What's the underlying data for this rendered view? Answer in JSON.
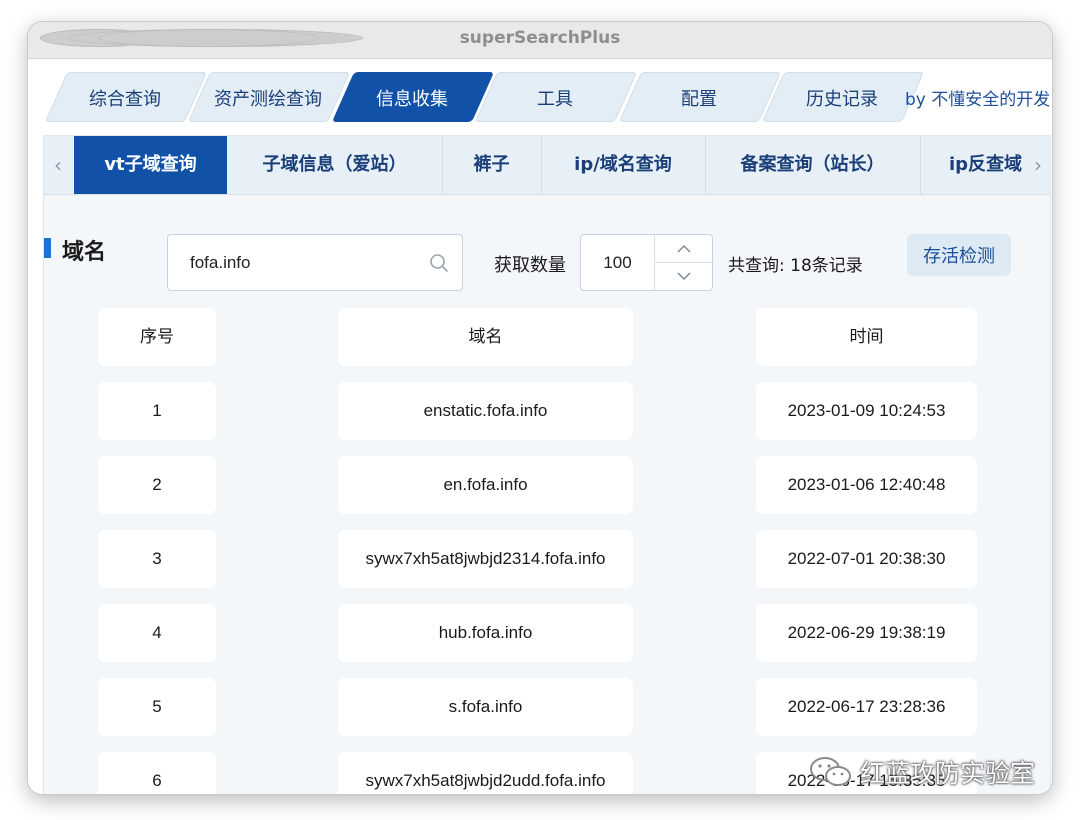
{
  "window": {
    "title": "superSearchPlus"
  },
  "top_tabs": [
    {
      "label": "综合查询",
      "active": false
    },
    {
      "label": "资产测绘查询",
      "active": false
    },
    {
      "label": "信息收集",
      "active": true
    },
    {
      "label": "工具",
      "active": false
    },
    {
      "label": "配置",
      "active": false
    },
    {
      "label": "历史记录",
      "active": false
    }
  ],
  "byline": "by 不懂安全的开发",
  "sub_tabs": [
    {
      "label": "vt子域查询",
      "active": true
    },
    {
      "label": "子域信息（爱站）",
      "active": false
    },
    {
      "label": "裤子",
      "active": false
    },
    {
      "label": "ip/域名查询",
      "active": false
    },
    {
      "label": "备案查询（站长）",
      "active": false
    },
    {
      "label": "ip反查域",
      "active": false
    }
  ],
  "search": {
    "section_title": "域名",
    "value": "fofa.info",
    "count_label": "获取数量",
    "count_value": "100",
    "total_text": "共查询: 18条记录",
    "alive_button": "存活检测"
  },
  "table": {
    "headers": [
      "序号",
      "域名",
      "时间"
    ],
    "rows": [
      [
        "1",
        "enstatic.fofa.info",
        "2023-01-09 10:24:53"
      ],
      [
        "2",
        "en.fofa.info",
        "2023-01-06 12:40:48"
      ],
      [
        "3",
        "sywx7xh5at8jwbjd2314.fofa.info",
        "2022-07-01 20:38:30"
      ],
      [
        "4",
        "hub.fofa.info",
        "2022-06-29 19:38:19"
      ],
      [
        "5",
        "s.fofa.info",
        "2022-06-17 23:28:36"
      ],
      [
        "6",
        "sywx7xh5at8jwbjd2udd.fofa.info",
        "2022-06-17 15:35:35"
      ]
    ]
  },
  "watermark": "红蓝攻防实验室"
}
